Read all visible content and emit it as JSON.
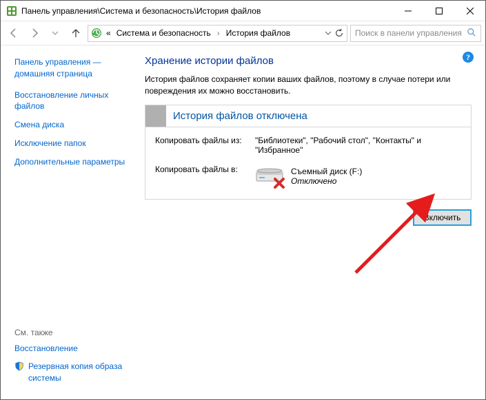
{
  "titlebar": {
    "title": "Панель управления\\Система и безопасность\\История файлов"
  },
  "addressbar": {
    "crumb_prefix": "«",
    "crumb1": "Система и безопасность",
    "crumb2": "История файлов"
  },
  "search": {
    "placeholder": "Поиск в панели управления"
  },
  "sidebar": {
    "home": "Панель управления — домашняя страница",
    "links": [
      "Восстановление личных файлов",
      "Смена диска",
      "Исключение папок",
      "Дополнительные параметры"
    ],
    "see_also": "См. также",
    "bottom_links": [
      "Восстановление",
      "Резервная копия образа системы"
    ]
  },
  "main": {
    "title": "Хранение истории файлов",
    "description": "История файлов сохраняет копии ваших файлов, поэтому в случае потери или повреждения их можно восстановить.",
    "status_title": "История файлов отключена",
    "copy_from_label": "Копировать файлы из:",
    "copy_from_value": "\"Библиотеки\", \"Рабочий стол\", \"Контакты\" и \"Избранное\"",
    "copy_to_label": "Копировать файлы в:",
    "drive_name": "Съемный диск (F:)",
    "drive_status": "Отключено",
    "enable_button": "Включить"
  }
}
